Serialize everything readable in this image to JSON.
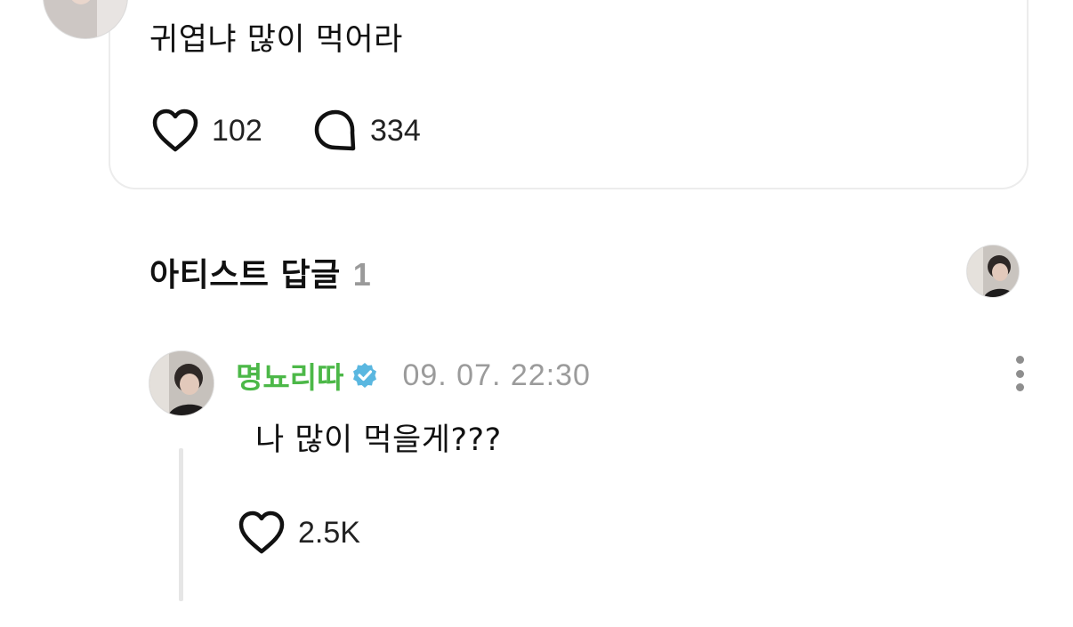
{
  "post": {
    "text": "귀엽냐 많이 먹어라",
    "likes": "102",
    "comments": "334"
  },
  "artist_reply_section": {
    "title": "아티스트 답글",
    "count": "1"
  },
  "reply": {
    "author": "명뇨리따",
    "verified": true,
    "timestamp": "09. 07. 22:30",
    "text": "나 많이 먹을게???",
    "likes": "2.5K"
  },
  "colors": {
    "author_green": "#4cb848",
    "verified_blue": "#5ab7e0",
    "muted_gray": "#9b9b9b",
    "thread_line": "#e6e6e6"
  },
  "icons": [
    "heart-icon",
    "comment-bubble-icon",
    "verified-badge-icon",
    "more-options-icon"
  ]
}
